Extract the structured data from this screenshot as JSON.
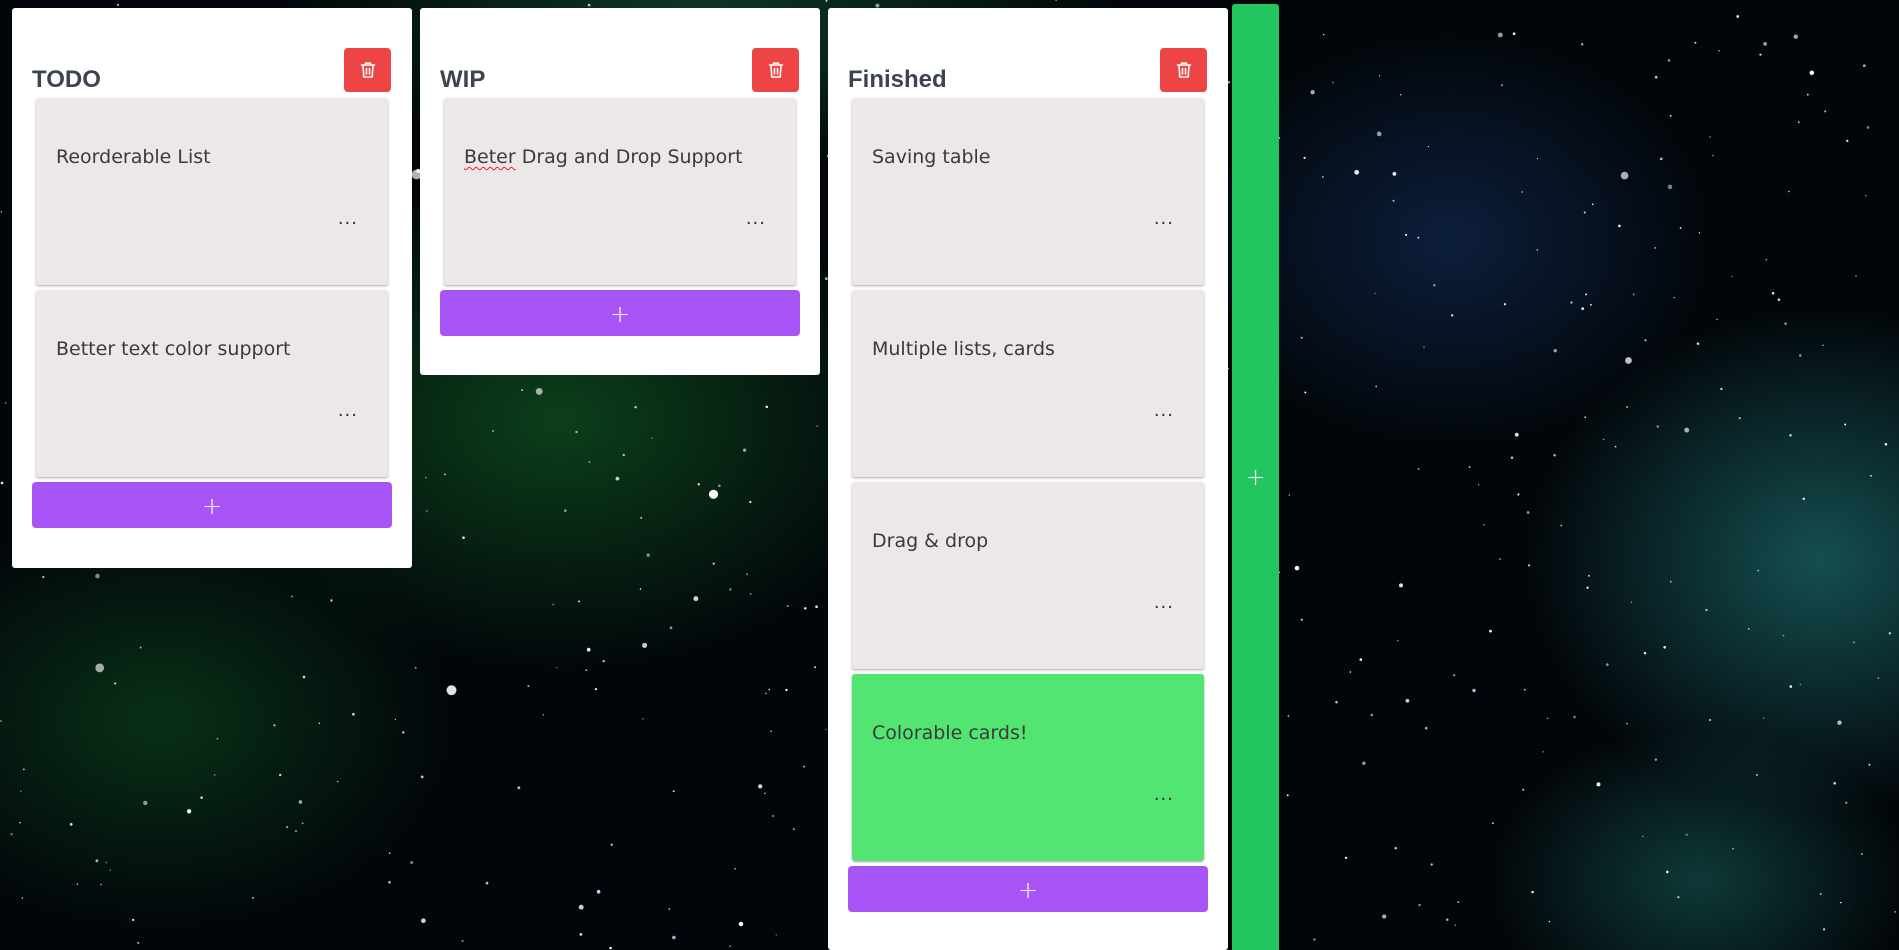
{
  "board": {
    "colors": {
      "list_bg": "#ffffff",
      "card_bg": "#ece8e7",
      "card_green": "#52e572",
      "delete_red": "#ef4444",
      "add_purple": "#a855f7",
      "add_list_green": "#22c55e",
      "title": "#3d4451"
    },
    "lists": [
      {
        "title": "TODO",
        "cards": [
          {
            "text": "Reorderable List",
            "menu": "...",
            "color": "default"
          },
          {
            "text": "Better text color support",
            "menu": "...",
            "color": "default"
          }
        ],
        "add_label": "+"
      },
      {
        "title": "WIP",
        "cards": [
          {
            "text_misspelled": "Beter",
            "text_rest": " Drag and Drop Support",
            "menu": "...",
            "color": "default"
          }
        ],
        "add_label": "+"
      },
      {
        "title": "Finished",
        "cards": [
          {
            "text": "Saving table",
            "menu": "...",
            "color": "default"
          },
          {
            "text": "Multiple lists, cards",
            "menu": "...",
            "color": "default"
          },
          {
            "text": "Drag & drop",
            "menu": "...",
            "color": "default"
          },
          {
            "text": "Colorable cards!",
            "menu": "...",
            "color": "green"
          }
        ],
        "add_label": "+"
      }
    ],
    "add_list_label": "+",
    "icons": {
      "delete": "trash-icon",
      "add": "plus-icon",
      "menu": "ellipsis-icon"
    }
  }
}
